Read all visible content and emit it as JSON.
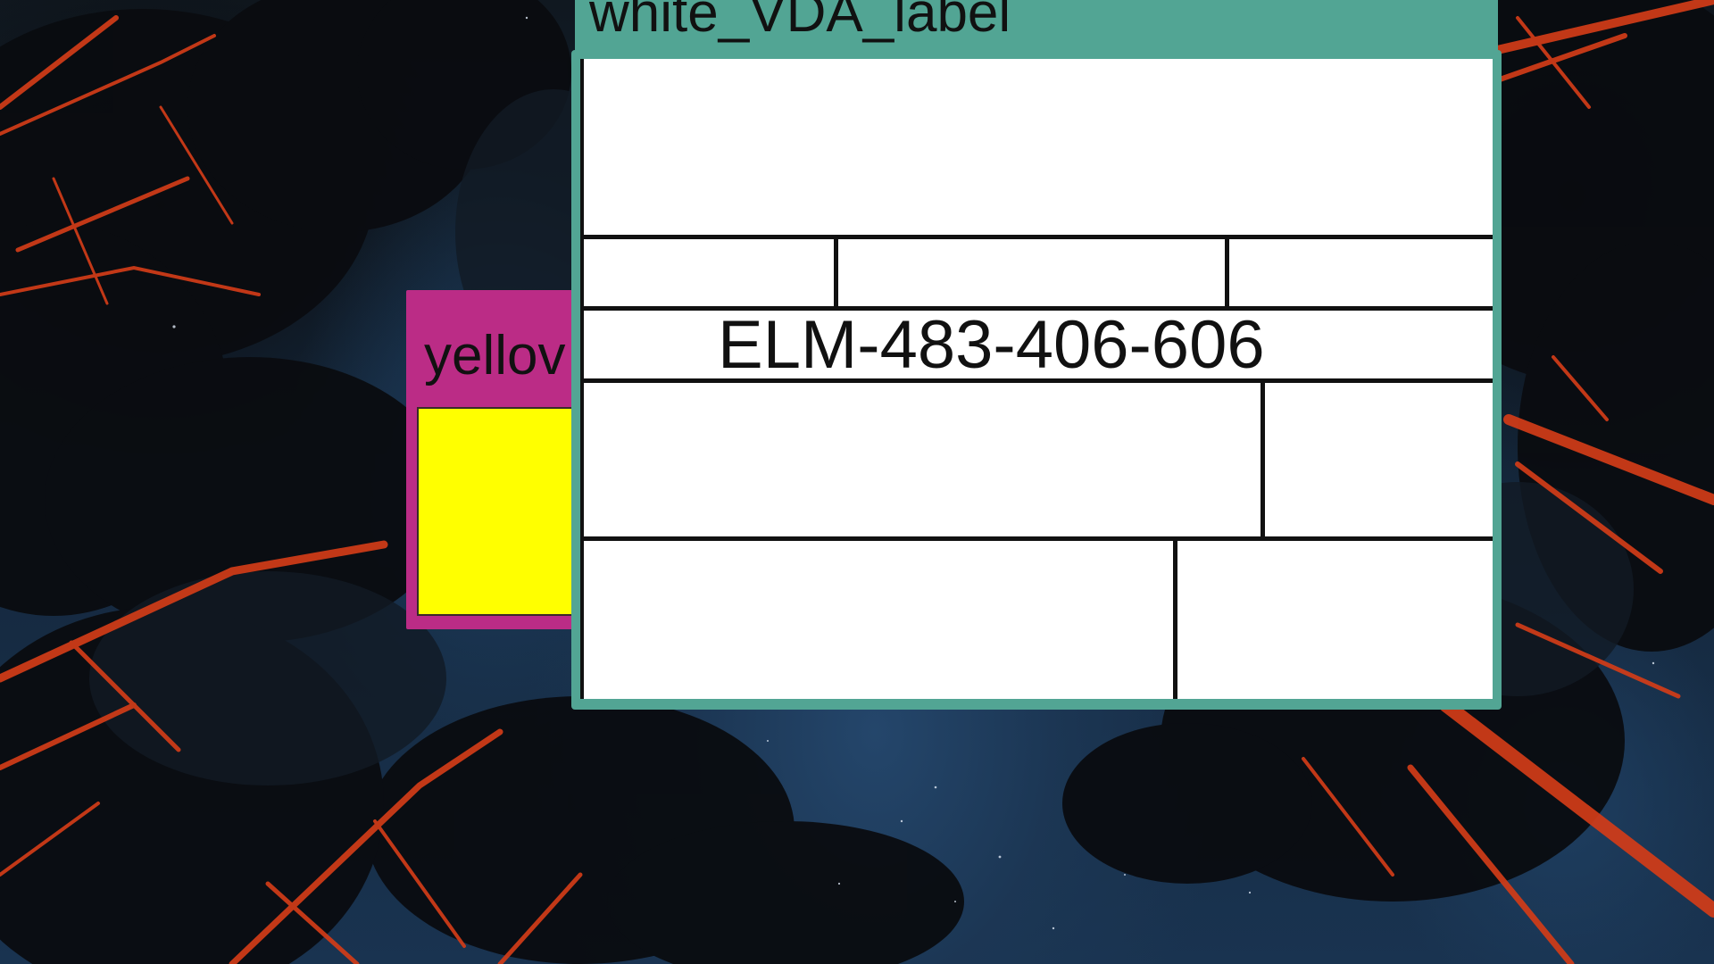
{
  "desktop": {
    "wallpaper": "night-forest-sky",
    "colors": {
      "sky": "#1b3a5a",
      "foliage": "#0b0d10",
      "branches": "#d8401c"
    }
  },
  "windows": [
    {
      "id": "yellow",
      "title": "yellov",
      "titlebar_color": "#bb2c86",
      "content_color": "#ffff00"
    },
    {
      "id": "white",
      "title": "white_VDA_label",
      "titlebar_color": "#52a594",
      "content_color": "#ffffff"
    }
  ],
  "label": {
    "barcode_text": "ELM-483-406-606"
  }
}
